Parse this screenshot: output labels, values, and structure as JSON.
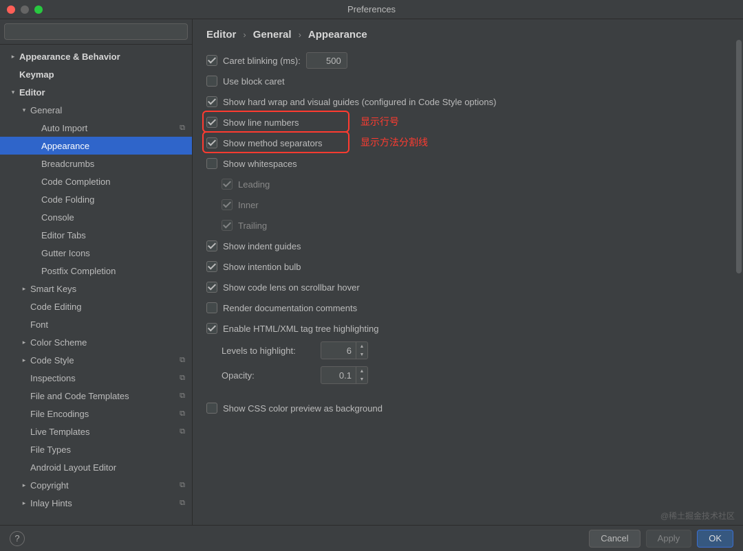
{
  "window": {
    "title": "Preferences"
  },
  "search": {
    "placeholder": ""
  },
  "sidebar": {
    "items": [
      {
        "label": "Appearance & Behavior",
        "depth": 0,
        "arrow": "right",
        "bold": true,
        "copy": false
      },
      {
        "label": "Keymap",
        "depth": 0,
        "arrow": "",
        "bold": true,
        "copy": false
      },
      {
        "label": "Editor",
        "depth": 0,
        "arrow": "down",
        "bold": true,
        "copy": false
      },
      {
        "label": "General",
        "depth": 1,
        "arrow": "down",
        "bold": false,
        "copy": false
      },
      {
        "label": "Auto Import",
        "depth": 2,
        "arrow": "",
        "bold": false,
        "copy": true
      },
      {
        "label": "Appearance",
        "depth": 2,
        "arrow": "",
        "bold": false,
        "selected": true,
        "copy": false
      },
      {
        "label": "Breadcrumbs",
        "depth": 2,
        "arrow": "",
        "bold": false,
        "copy": false
      },
      {
        "label": "Code Completion",
        "depth": 2,
        "arrow": "",
        "bold": false,
        "copy": false
      },
      {
        "label": "Code Folding",
        "depth": 2,
        "arrow": "",
        "bold": false,
        "copy": false
      },
      {
        "label": "Console",
        "depth": 2,
        "arrow": "",
        "bold": false,
        "copy": false
      },
      {
        "label": "Editor Tabs",
        "depth": 2,
        "arrow": "",
        "bold": false,
        "copy": false
      },
      {
        "label": "Gutter Icons",
        "depth": 2,
        "arrow": "",
        "bold": false,
        "copy": false
      },
      {
        "label": "Postfix Completion",
        "depth": 2,
        "arrow": "",
        "bold": false,
        "copy": false
      },
      {
        "label": "Smart Keys",
        "depth": 1,
        "arrow": "right",
        "bold": false,
        "copy": false
      },
      {
        "label": "Code Editing",
        "depth": 1,
        "arrow": "",
        "bold": false,
        "copy": false
      },
      {
        "label": "Font",
        "depth": 1,
        "arrow": "",
        "bold": false,
        "copy": false
      },
      {
        "label": "Color Scheme",
        "depth": 1,
        "arrow": "right",
        "bold": false,
        "copy": false
      },
      {
        "label": "Code Style",
        "depth": 1,
        "arrow": "right",
        "bold": false,
        "copy": true
      },
      {
        "label": "Inspections",
        "depth": 1,
        "arrow": "",
        "bold": false,
        "copy": true
      },
      {
        "label": "File and Code Templates",
        "depth": 1,
        "arrow": "",
        "bold": false,
        "copy": true
      },
      {
        "label": "File Encodings",
        "depth": 1,
        "arrow": "",
        "bold": false,
        "copy": true
      },
      {
        "label": "Live Templates",
        "depth": 1,
        "arrow": "",
        "bold": false,
        "copy": true
      },
      {
        "label": "File Types",
        "depth": 1,
        "arrow": "",
        "bold": false,
        "copy": false
      },
      {
        "label": "Android Layout Editor",
        "depth": 1,
        "arrow": "",
        "bold": false,
        "copy": false
      },
      {
        "label": "Copyright",
        "depth": 1,
        "arrow": "right",
        "bold": false,
        "copy": true
      },
      {
        "label": "Inlay Hints",
        "depth": 1,
        "arrow": "right",
        "bold": false,
        "copy": true
      }
    ]
  },
  "breadcrumb": {
    "a": "Editor",
    "b": "General",
    "c": "Appearance"
  },
  "opts": {
    "caret_blinking": "Caret blinking (ms):",
    "caret_blinking_value": "500",
    "use_block_caret": "Use block caret",
    "show_hard_wrap": "Show hard wrap and visual guides (configured in Code Style options)",
    "show_line_numbers": "Show line numbers",
    "show_method_separators": "Show method separators",
    "show_whitespaces": "Show whitespaces",
    "leading": "Leading",
    "inner": "Inner",
    "trailing": "Trailing",
    "show_indent_guides": "Show indent guides",
    "show_intention_bulb": "Show intention bulb",
    "show_code_lens": "Show code lens on scrollbar hover",
    "render_doc": "Render documentation comments",
    "enable_html_tree": "Enable HTML/XML tag tree highlighting",
    "levels_label": "Levels to highlight:",
    "levels_value": "6",
    "opacity_label": "Opacity:",
    "opacity_value": "0.1",
    "show_css_color": "Show CSS color preview as background"
  },
  "annotations": {
    "show_line_numbers": "显示行号",
    "show_method_separators": "显示方法分割线"
  },
  "footer": {
    "cancel": "Cancel",
    "apply": "Apply",
    "ok": "OK"
  },
  "watermark": "@稀土掘金技术社区"
}
